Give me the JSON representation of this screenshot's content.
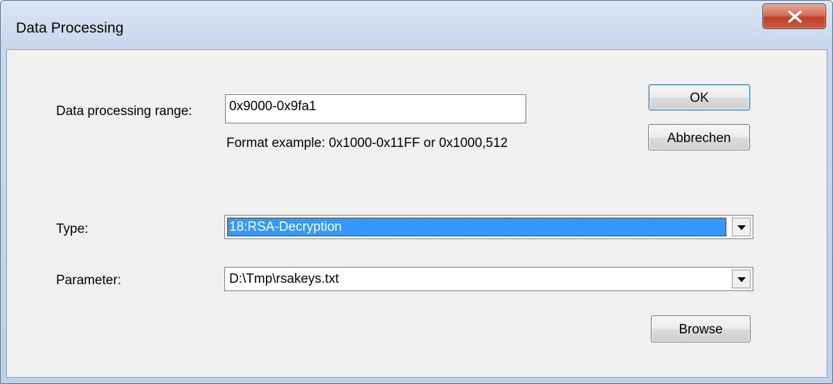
{
  "window": {
    "title": "Data Processing",
    "close_icon": "close-x-icon",
    "accent_color": "#3399ff",
    "close_color": "#c84b36"
  },
  "range": {
    "label": "Data processing range:",
    "value": "0x9000-0x9fa1",
    "hint": "Format example: 0x1000-0x11FF or 0x1000,512"
  },
  "type": {
    "label": "Type:",
    "selected": "18:RSA-Decryption",
    "dropdown_icon": "chevron-down-icon"
  },
  "parameter": {
    "label": "Parameter:",
    "value": "D:\\Tmp\\rsakeys.txt",
    "dropdown_icon": "chevron-down-icon"
  },
  "buttons": {
    "ok": "OK",
    "cancel": "Abbrechen",
    "browse": "Browse"
  }
}
